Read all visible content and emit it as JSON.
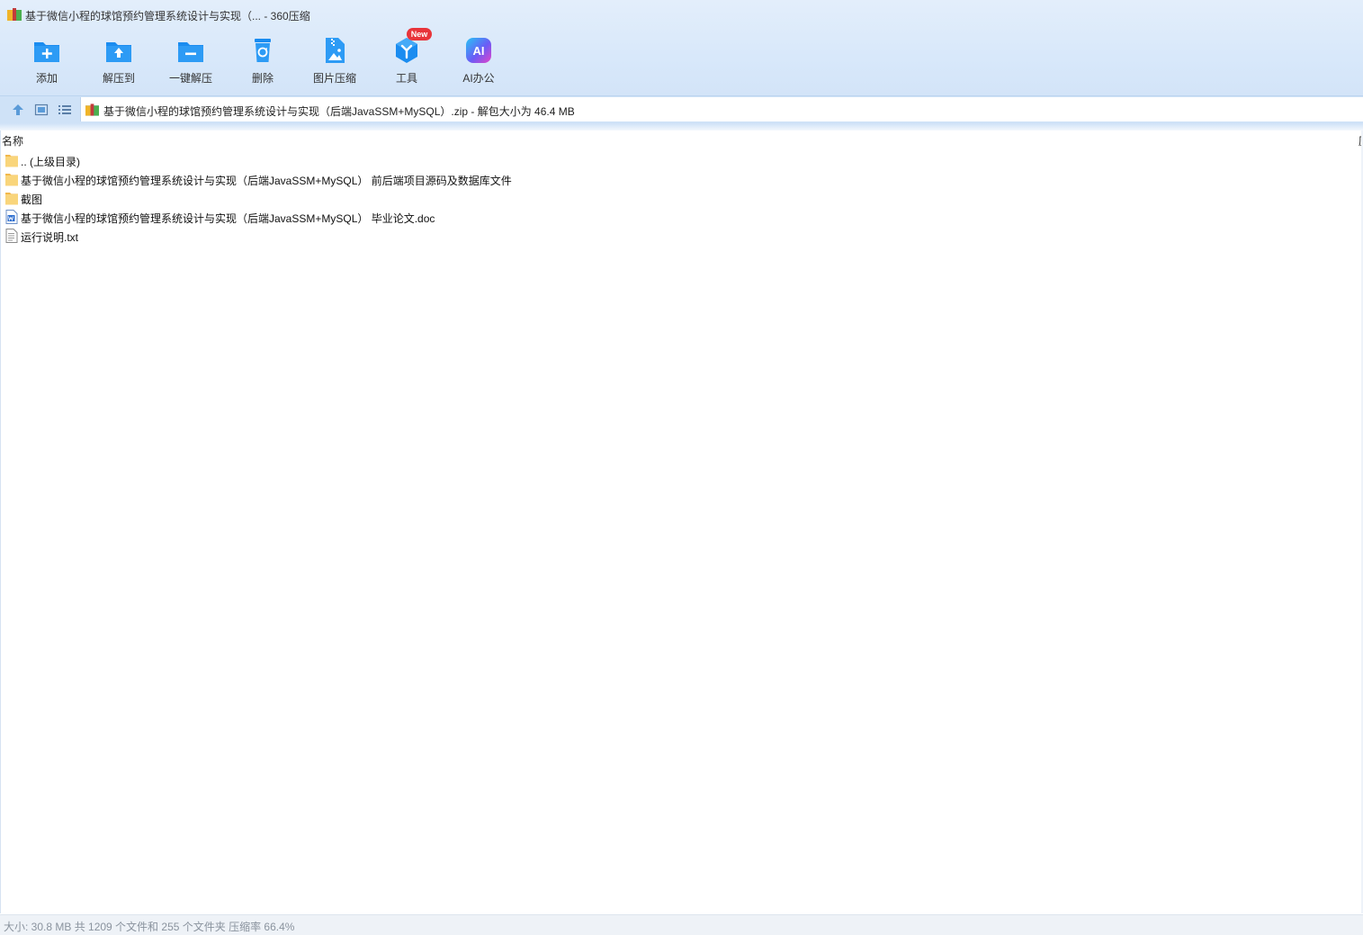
{
  "window": {
    "title": "基于微信小程的球馆预约管理系统设计与实现（... - 360压缩"
  },
  "toolbar": {
    "items": [
      {
        "label": "添加",
        "icon": "add-archive-icon"
      },
      {
        "label": "解压到",
        "icon": "extract-to-icon"
      },
      {
        "label": "一键解压",
        "icon": "one-click-extract-icon"
      },
      {
        "label": "删除",
        "icon": "delete-icon"
      },
      {
        "label": "图片压缩",
        "icon": "image-compress-icon"
      },
      {
        "label": "工具",
        "icon": "tools-icon"
      },
      {
        "label": "AI办公",
        "icon": "ai-office-icon"
      }
    ],
    "new_badge": "New",
    "ai_icon_text": "AI"
  },
  "address": {
    "text": "基于微信小程的球馆预约管理系统设计与实现（后端JavaSSM+MySQL）.zip - 解包大小为 46.4 MB"
  },
  "list": {
    "column_name": "名称",
    "column_next": "压",
    "rows": [
      {
        "name": ".. (上级目录)",
        "icon": "folder-icon"
      },
      {
        "name": "基于微信小程的球馆预约管理系统设计与实现（后端JavaSSM+MySQL） 前后端项目源码及数据库文件",
        "icon": "folder-icon"
      },
      {
        "name": "截图",
        "icon": "folder-icon"
      },
      {
        "name": "基于微信小程的球馆预约管理系统设计与实现（后端JavaSSM+MySQL） 毕业论文.doc",
        "icon": "word-doc-icon"
      },
      {
        "name": "运行说明.txt",
        "icon": "text-file-icon"
      }
    ]
  },
  "status": {
    "text": "大小: 30.8 MB 共 1209 个文件和 255 个文件夹 压缩率 66.4%"
  },
  "colors": {
    "accent_blue": "#1a8cf0",
    "folder_yellow": "#f7c85a",
    "badge_red": "#e8343a",
    "status_text": "#8a939e"
  }
}
